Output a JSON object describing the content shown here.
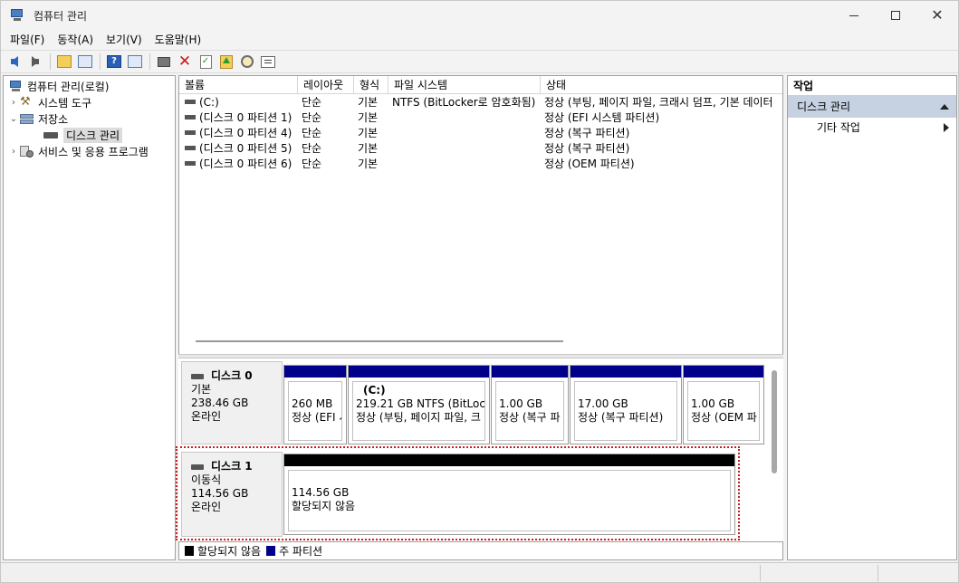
{
  "window": {
    "title": "컴퓨터 관리"
  },
  "menu": [
    "파일(F)",
    "동작(A)",
    "보기(V)",
    "도움말(H)"
  ],
  "toolbar": {
    "icons": [
      "back-arrow-icon",
      "forward-arrow-icon",
      "up-folder-icon",
      "show-hide-console-tree-icon",
      "help-icon",
      "show-hide-action-pane-icon",
      "connect-icon",
      "delete-icon",
      "check-icon",
      "open-icon",
      "search-icon",
      "properties-icon"
    ]
  },
  "tree": {
    "root": "컴퓨터 관리(로컬)",
    "system_tools": "시스템 도구",
    "storage": "저장소",
    "disk_management": "디스크 관리",
    "services": "서비스 및 응용 프로그램"
  },
  "volumes": {
    "headers": [
      "볼륨",
      "레이아웃",
      "형식",
      "파일 시스템",
      "상태"
    ],
    "rows": [
      {
        "volume": "(C:)",
        "layout": "단순",
        "type": "기본",
        "fs": "NTFS (BitLocker로 암호화됨)",
        "status": "정상 (부팅, 페이지 파일, 크래시 덤프, 기본 데이터"
      },
      {
        "volume": "(디스크 0 파티션 1)",
        "layout": "단순",
        "type": "기본",
        "fs": "",
        "status": "정상 (EFI 시스템 파티션)"
      },
      {
        "volume": "(디스크 0 파티션 4)",
        "layout": "단순",
        "type": "기본",
        "fs": "",
        "status": "정상 (복구 파티션)"
      },
      {
        "volume": "(디스크 0 파티션 5)",
        "layout": "단순",
        "type": "기본",
        "fs": "",
        "status": "정상 (복구 파티션)"
      },
      {
        "volume": "(디스크 0 파티션 6)",
        "layout": "단순",
        "type": "기본",
        "fs": "",
        "status": "정상 (OEM 파티션)"
      }
    ]
  },
  "disks": [
    {
      "name": "디스크 0",
      "kind": "기본",
      "size": "238.46 GB",
      "state": "온라인",
      "partitions": [
        {
          "name": "",
          "size": "260 MB",
          "status": "정상 (EFI 시"
        },
        {
          "name": "(C:)",
          "size": "219.21 GB NTFS (BitLocke",
          "status": "정상 (부팅, 페이지 파일, 크"
        },
        {
          "name": "",
          "size": "1.00 GB",
          "status": "정상 (복구 파"
        },
        {
          "name": "",
          "size": "17.00 GB",
          "status": "정상 (복구 파티션)"
        },
        {
          "name": "",
          "size": "1.00 GB",
          "status": "정상 (OEM 파"
        }
      ]
    },
    {
      "name": "디스크 1",
      "kind": "이동식",
      "size": "114.56 GB",
      "state": "온라인",
      "partitions": [
        {
          "name": "",
          "size": "114.56 GB",
          "status": "할당되지 않음"
        }
      ]
    }
  ],
  "legend": [
    {
      "label": "할당되지 않음",
      "color": "#000000"
    },
    {
      "label": "주 파티션",
      "color": "#00008b"
    }
  ],
  "actions": {
    "header": "작업",
    "section": "디스크 관리",
    "item": "기타 작업"
  }
}
